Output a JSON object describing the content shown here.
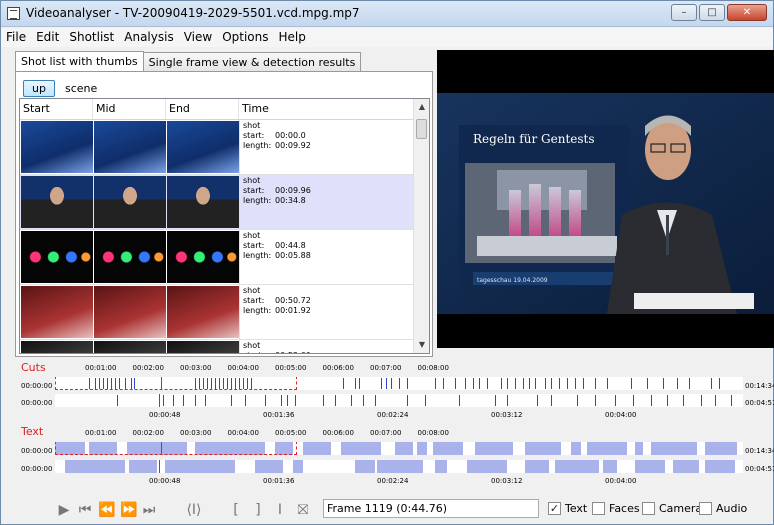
{
  "window": {
    "title": "Videoanalyser - TV-20090419-2029-5501.vcd.mpg.mp7",
    "minimize": "–",
    "maximize": "□",
    "close": "✕"
  },
  "menu": [
    "File",
    "Edit",
    "Shotlist",
    "Analysis",
    "View",
    "Options",
    "Help"
  ],
  "tabs": [
    "Shot list with thumbs",
    "Single frame view & detection results"
  ],
  "level": {
    "up_label": "up",
    "current": "scene"
  },
  "columns": [
    "Start",
    "Mid",
    "End",
    "Time"
  ],
  "shots": [
    {
      "type": "shot",
      "start_label": "start:",
      "start": "00:00.0",
      "length_label": "length:",
      "length": "00:09.92",
      "theme": "blue"
    },
    {
      "type": "shot",
      "start_label": "start:",
      "start": "00:09.96",
      "length_label": "length:",
      "length": "00:34.8",
      "theme": "anchor"
    },
    {
      "type": "shot",
      "start_label": "start:",
      "start": "00:44.8",
      "length_label": "length:",
      "length": "00:05.88",
      "theme": "lights"
    },
    {
      "type": "shot",
      "start_label": "start:",
      "start": "00:50.72",
      "length_label": "length:",
      "length": "00:01.92",
      "theme": "red"
    },
    {
      "type": "shot",
      "start_label": "start:",
      "start": "00:52.60",
      "length_label": "length:",
      "length": "",
      "theme": "dark"
    }
  ],
  "video": {
    "headline": "Regeln für Gentests",
    "banner": "tagesschau 19.04.2009"
  },
  "timeline": {
    "cuts_label": "Cuts",
    "text_label": "Text",
    "top_ticks": [
      "00:01:00",
      "00:02:00",
      "00:03:00",
      "00:04:00",
      "00:05:00",
      "00:06:00",
      "00:07:00",
      "00:08:00"
    ],
    "zoom_ticks": [
      "00:00:48",
      "00:01:36",
      "00:02:24",
      "00:03:12",
      "00:04:00"
    ],
    "row1_start": "00:00:00",
    "row1_end": "00:14:34",
    "row2_start": "00:00:00",
    "row2_end": "00:04:51"
  },
  "toolbar": {
    "frame": "Frame 1119 (0:44.76)",
    "checks": [
      {
        "label": "Text",
        "checked": true
      },
      {
        "label": "Faces",
        "checked": false
      },
      {
        "label": "Camera",
        "checked": false
      },
      {
        "label": "Audio",
        "checked": false
      }
    ]
  },
  "colors": {
    "cut_marker": "#3145c8",
    "text_segment": "#a9b2ea",
    "cursor": "#e02020",
    "selection": "#dfe1fa"
  }
}
